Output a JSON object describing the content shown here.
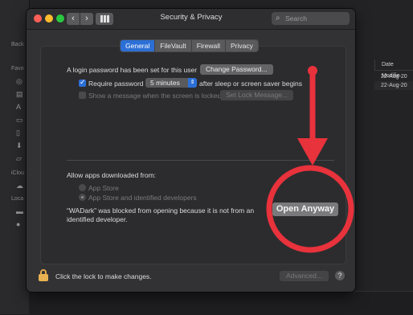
{
  "background_finder": {
    "sidebar_labels": [
      "Back",
      "Favo",
      "iClou",
      "Loca"
    ],
    "columns": {
      "date_header": "Date Modifie",
      "rows": [
        "22-Aug-20",
        "22-Aug-20"
      ]
    }
  },
  "window": {
    "title": "Security & Privacy",
    "search_placeholder": "Search",
    "nav": {
      "back": "‹",
      "forward": "›"
    }
  },
  "tabs": [
    {
      "label": "General",
      "selected": true
    },
    {
      "label": "FileVault",
      "selected": false
    },
    {
      "label": "Firewall",
      "selected": false
    },
    {
      "label": "Privacy",
      "selected": false
    }
  ],
  "general": {
    "login_text": "A login password has been set for this user",
    "change_password_label": "Change Password...",
    "require_password_label": "Require password",
    "require_password_checked": true,
    "require_delay_value": "5 minutes",
    "after_sleep_text": "after sleep or screen saver begins",
    "show_message_label": "Show a message when the screen is locked",
    "show_message_checked": false,
    "set_lock_message_label": "Set Lock Message...",
    "allow_apps_title": "Allow apps downloaded from:",
    "option_app_store": "App Store",
    "option_identified": "App Store and identified developers",
    "blocked_message_line1": "“WADark” was blocked from opening because it is not from an",
    "blocked_message_line2": "identified developer.",
    "open_anyway_label": "Open Anyway"
  },
  "footer": {
    "lock_text": "Click the lock to make changes.",
    "advanced_label": "Advanced...",
    "help_label": "?"
  },
  "colors": {
    "accent": "#2c6fd6",
    "annotation_red": "#e8323c"
  }
}
